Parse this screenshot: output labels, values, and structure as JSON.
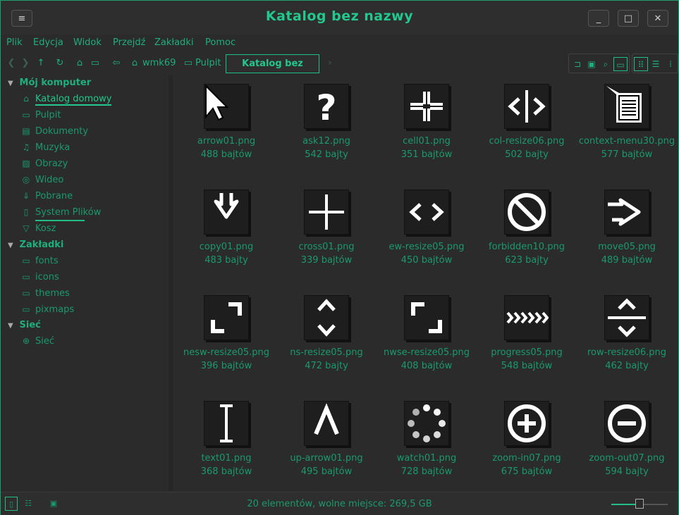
{
  "window": {
    "title": "Katalog bez nazwy"
  },
  "titlebar": {
    "menu_icon": "≡",
    "minimize_icon": "_",
    "maximize_icon": "□",
    "close_icon": "✕"
  },
  "menubar": {
    "items": [
      "Plik",
      "Edycja",
      "Widok",
      "Przejdź",
      "Zakładki",
      "Pomoc"
    ]
  },
  "toolbar": {
    "breadcrumbs": [
      "wmk69",
      "Pulpit"
    ],
    "current": "Katalog bez nazwy"
  },
  "sidebar": {
    "sections": [
      {
        "label": "Mój komputer",
        "items": [
          "Katalog domowy",
          "Pulpit",
          "Dokumenty",
          "Muzyka",
          "Obrazy",
          "Wideo",
          "Pobrane",
          "System Plików",
          "Kosz"
        ]
      },
      {
        "label": "Zakładki",
        "items": [
          "fonts",
          "icons",
          "themes",
          "pixmaps"
        ]
      },
      {
        "label": "Sieć",
        "items": [
          "Sieć"
        ]
      }
    ],
    "filesystem_usage_fraction": 0.6
  },
  "files": [
    {
      "name": "arrow01.png",
      "size": "488 bajtów",
      "icon": "arrow-cursor"
    },
    {
      "name": "ask12.png",
      "size": "542 bajty",
      "icon": "question-cursor"
    },
    {
      "name": "cell01.png",
      "size": "351 bajtów",
      "icon": "cell-cursor"
    },
    {
      "name": "col-resize06.png",
      "size": "502 bajty",
      "icon": "col-resize-cursor"
    },
    {
      "name": "context-menu30.png",
      "size": "577 bajtów",
      "icon": "context-menu-cursor"
    },
    {
      "name": "copy01.png",
      "size": "483 bajty",
      "icon": "copy-cursor"
    },
    {
      "name": "cross01.png",
      "size": "339 bajtów",
      "icon": "cross-cursor"
    },
    {
      "name": "ew-resize05.png",
      "size": "450 bajtów",
      "icon": "ew-resize-cursor"
    },
    {
      "name": "forbidden10.png",
      "size": "623 bajty",
      "icon": "forbidden-cursor"
    },
    {
      "name": "move05.png",
      "size": "489 bajtów",
      "icon": "move-cursor"
    },
    {
      "name": "nesw-resize05.png",
      "size": "396 bajtów",
      "icon": "nesw-resize-cursor"
    },
    {
      "name": "ns-resize05.png",
      "size": "472 bajty",
      "icon": "ns-resize-cursor"
    },
    {
      "name": "nwse-resize05.png",
      "size": "408 bajtów",
      "icon": "nwse-resize-cursor"
    },
    {
      "name": "progress05.png",
      "size": "548 bajtów",
      "icon": "progress-cursor"
    },
    {
      "name": "row-resize06.png",
      "size": "462 bajty",
      "icon": "row-resize-cursor"
    },
    {
      "name": "text01.png",
      "size": "368 bajtów",
      "icon": "text-cursor"
    },
    {
      "name": "up-arrow01.png",
      "size": "495 bajtów",
      "icon": "up-arrow-cursor"
    },
    {
      "name": "watch01.png",
      "size": "728 bajtów",
      "icon": "watch-cursor"
    },
    {
      "name": "zoom-in07.png",
      "size": "675 bajtów",
      "icon": "zoom-in-cursor"
    },
    {
      "name": "zoom-out07.png",
      "size": "594 bajty",
      "icon": "zoom-out-cursor"
    }
  ],
  "statusbar": {
    "text": "20 elementów, wolne miejsce: 269,5 GB",
    "zoom_fraction": 0.5
  },
  "colors": {
    "accent": "#1fbf86",
    "background": "#2b2b2b",
    "thumb_bg": "#1e1e1e",
    "icon_fg": "#ffffff"
  }
}
